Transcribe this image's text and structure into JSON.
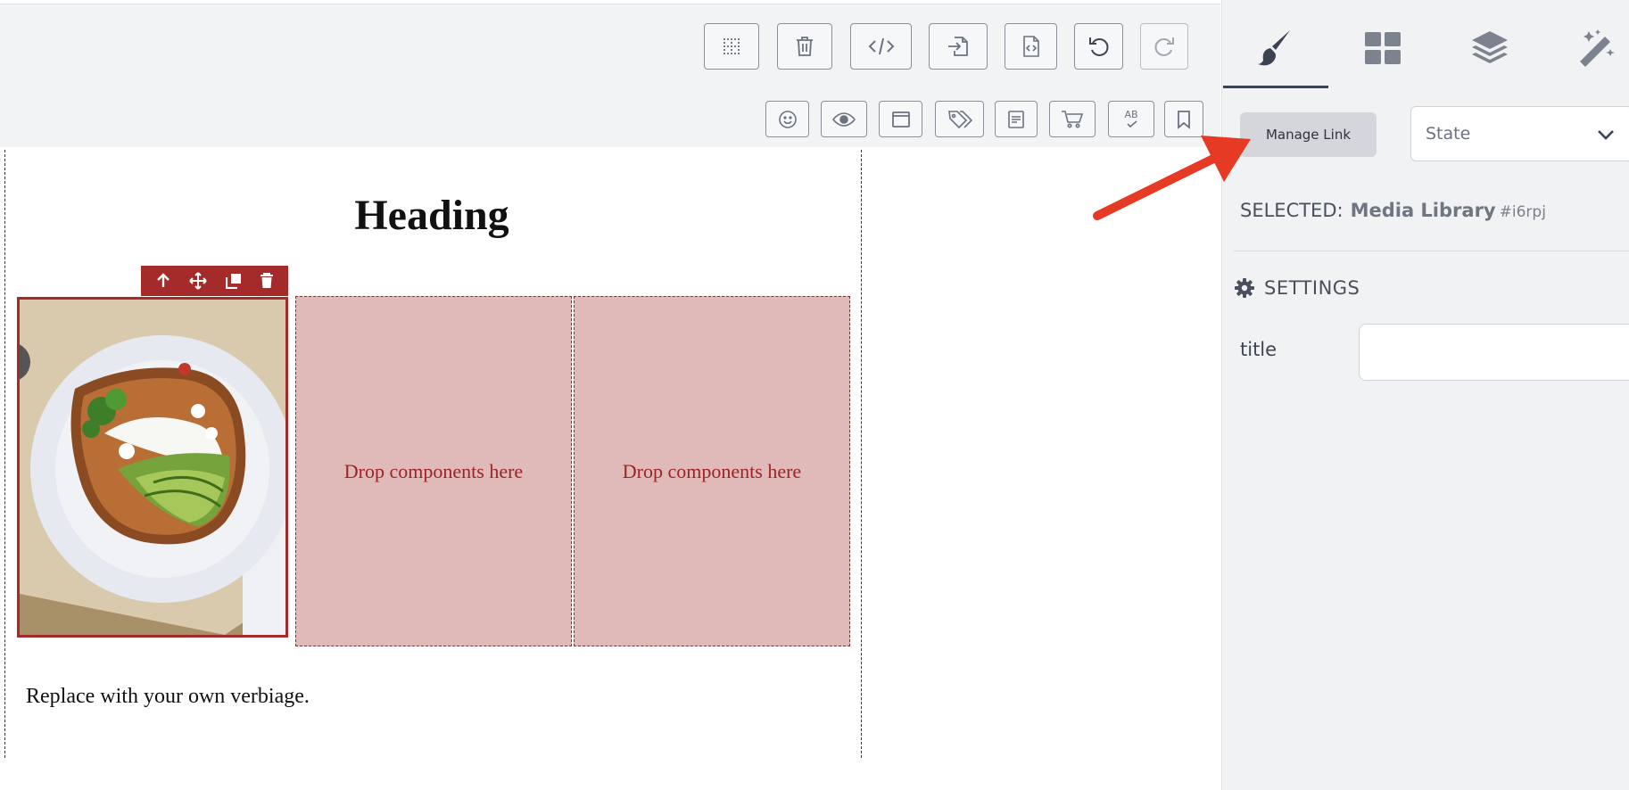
{
  "toolbar_top": {
    "buttons": [
      "grid-icon",
      "trash-icon",
      "code-icon",
      "import-icon",
      "export-file-icon",
      "undo-icon",
      "redo-icon"
    ]
  },
  "toolbar_second": {
    "buttons": [
      "smiley-icon",
      "eye-icon",
      "browser-window-icon",
      "tags-icon",
      "form-icon",
      "cart-icon",
      "spellcheck-icon",
      "bookmark-icon"
    ],
    "spellcheck_label": "AB"
  },
  "canvas": {
    "heading": "Heading",
    "drop_placeholder": "Drop components here",
    "body_text": "Replace with your own verbiage."
  },
  "panel": {
    "tabs": [
      "brush-icon",
      "blocks-icon",
      "layers-icon",
      "magic-wand-icon"
    ],
    "manage_link": "Manage Link",
    "state_placeholder": "State",
    "selected_label": "SELECTED:",
    "selected_component": "Media Library",
    "selected_id": "#i6rpj",
    "settings_heading": "SETTINGS",
    "title_label": "title",
    "title_value": ""
  },
  "colors": {
    "accent_selection": "#a52a2a",
    "drop_zone_bg": "#dfbab8",
    "drop_zone_text": "#9b2226",
    "panel_bg": "#f1f2f4",
    "annotation_arrow": "#e63a24"
  }
}
